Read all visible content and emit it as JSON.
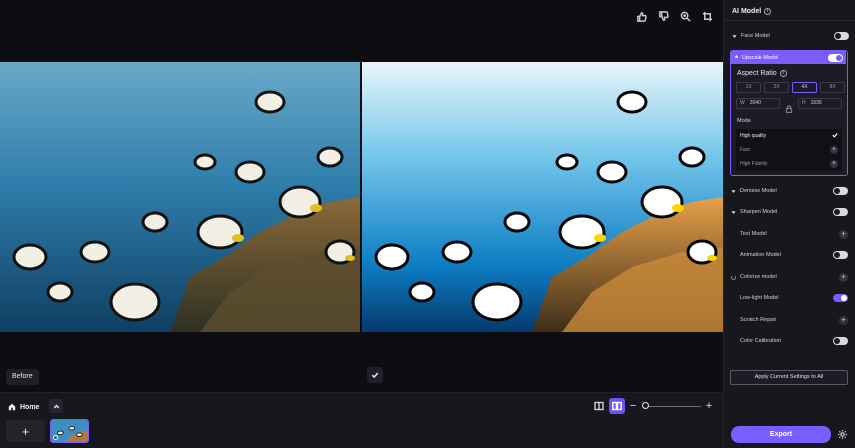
{
  "toolbar": {
    "icons": [
      "thumbs-up-icon",
      "thumbs-down-icon",
      "zoom-in-icon",
      "crop-icon"
    ]
  },
  "canvas": {
    "before_label": "Before"
  },
  "bottom_bar": {
    "home_label": "Home",
    "add_label": "+",
    "zoom_minus": "−",
    "zoom_plus": "+",
    "zoom_level_fraction": 0.05
  },
  "panel": {
    "title": "AI Model",
    "face_model": {
      "label": "Face Model",
      "enabled": false
    },
    "upscale_model": {
      "label": "Upscale Model",
      "enabled": true,
      "aspect_ratio_label": "Aspect Ratio",
      "scales": [
        "1X",
        "2X",
        "4X",
        "8X"
      ],
      "selected_scale": "4X",
      "width_key": "W",
      "width_value": "2040",
      "height_key": "H",
      "height_value": "1536",
      "mode_label": "Mode",
      "modes": [
        {
          "label": "High quality",
          "selected": true
        },
        {
          "label": "Fast",
          "selected": false
        },
        {
          "label": "High Fidelity",
          "selected": false
        }
      ]
    },
    "models": [
      {
        "label": "Denoise Model",
        "control": "toggle",
        "caret": true,
        "on": false
      },
      {
        "label": "Sharpen Model",
        "control": "toggle",
        "caret": true,
        "on": false
      },
      {
        "label": "Text Model",
        "control": "plus",
        "caret": false
      },
      {
        "label": "Animation Model",
        "control": "toggle",
        "caret": false,
        "on": false
      },
      {
        "label": "Colorize model",
        "control": "plus",
        "caret": false,
        "spinner": true
      },
      {
        "label": "Low-light Model",
        "control": "toggle",
        "caret": false,
        "on": true
      },
      {
        "label": "Scratch Repair",
        "control": "plus",
        "caret": false
      },
      {
        "label": "Color Calibration",
        "control": "toggle",
        "caret": false,
        "on": false
      }
    ],
    "apply_button": "Apply Current Settings to All",
    "export_button": "Export"
  },
  "colors": {
    "accent": "#7b5cff",
    "background": "#0d0d12",
    "panel": "#17171e"
  }
}
